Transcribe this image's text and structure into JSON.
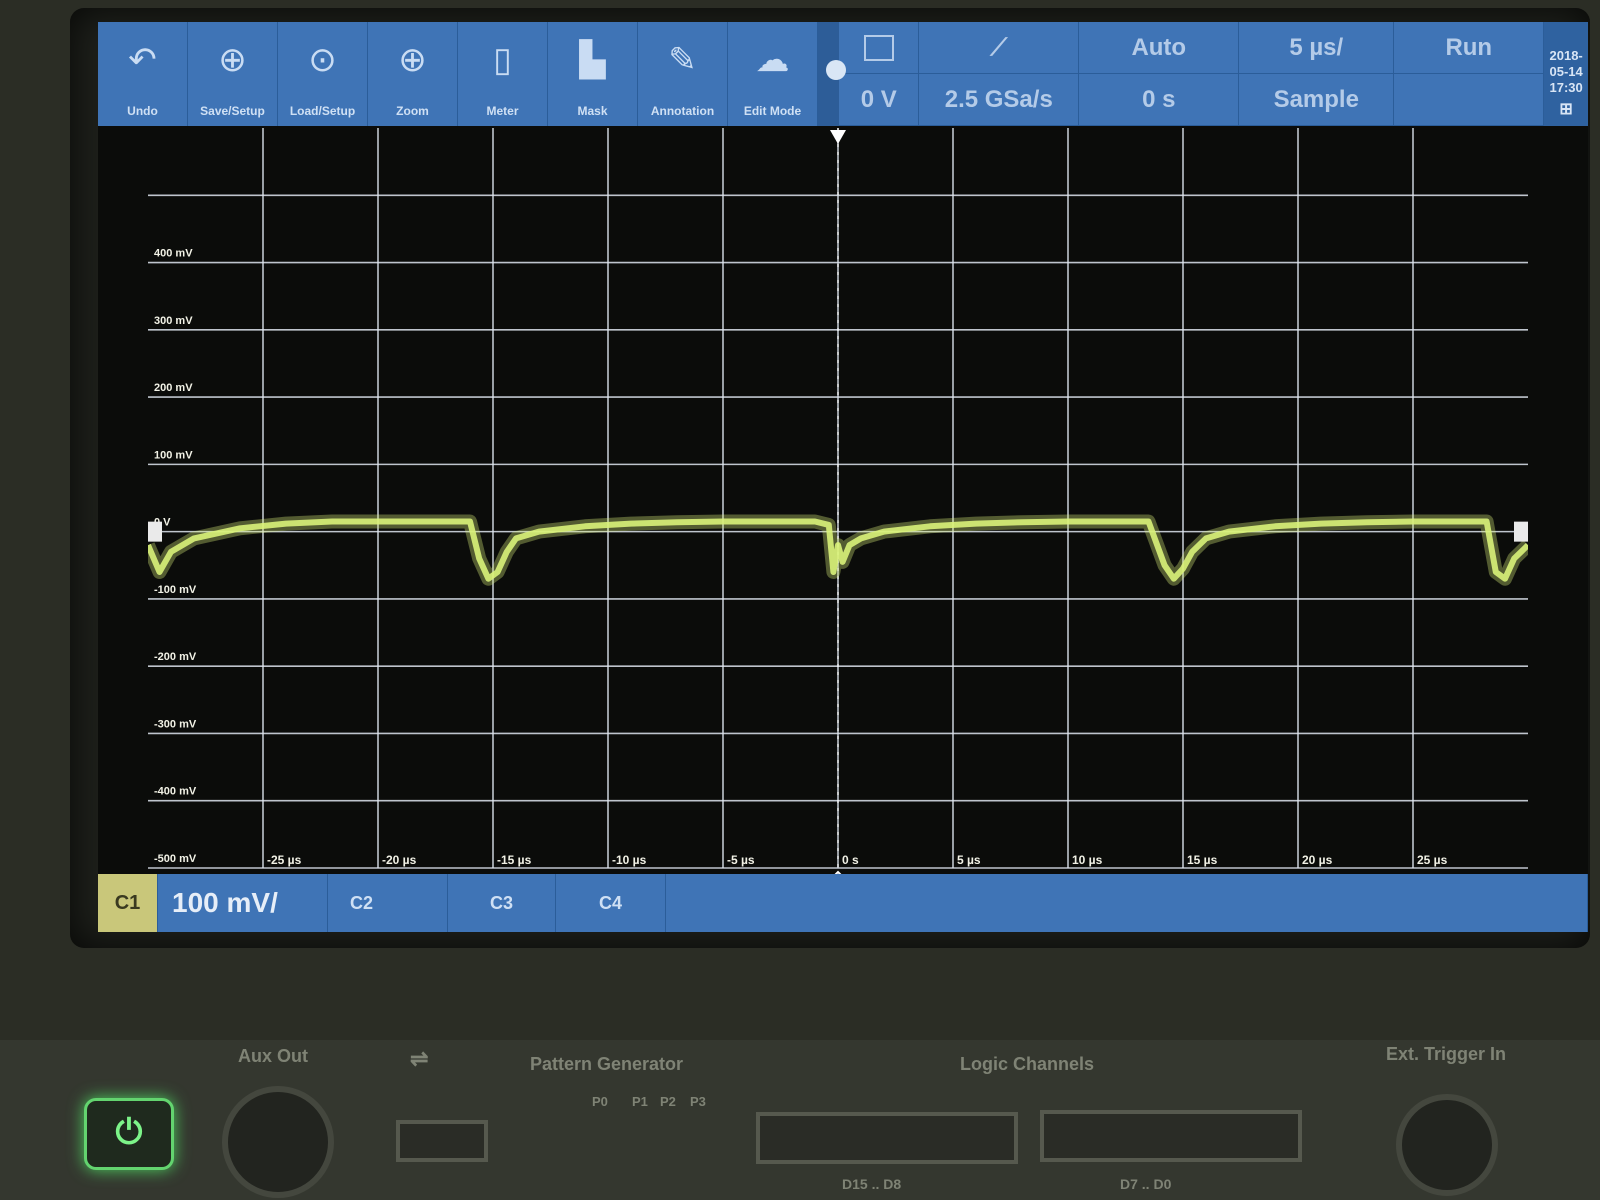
{
  "toolbar": {
    "tools": [
      {
        "label": "Undo",
        "icon": "undo-icon",
        "glyph": "↶"
      },
      {
        "label": "Save/Setup",
        "icon": "save-setup-icon",
        "glyph": "⊕"
      },
      {
        "label": "Load/Setup",
        "icon": "load-setup-icon",
        "glyph": "⊙"
      },
      {
        "label": "Zoom",
        "icon": "zoom-icon",
        "glyph": "⊕"
      },
      {
        "label": "Meter",
        "icon": "meter-icon",
        "glyph": "▯"
      },
      {
        "label": "Mask",
        "icon": "mask-icon",
        "glyph": "▙"
      },
      {
        "label": "Annotation",
        "icon": "annotation-icon",
        "glyph": "✎"
      },
      {
        "label": "Edit Mode",
        "icon": "edit-mode-icon",
        "glyph": "☁"
      }
    ],
    "trigger_type_icon": "trigger-edge-icon",
    "trigger_level": "0 V",
    "trigger_mode": "Auto",
    "sample_rate": "2.5 GSa/s",
    "time_scale": "5 µs/",
    "time_offset": "0 s",
    "run_state": "Run",
    "acquire_mode": "Sample",
    "date": "2018-05-14",
    "time": "17:30"
  },
  "chart_data": {
    "type": "line",
    "title": "",
    "xlabel": "",
    "ylabel": "",
    "x_unit": "µs",
    "y_unit": "mV",
    "xlim": [
      -30,
      30
    ],
    "ylim": [
      -500,
      500
    ],
    "grid": true,
    "x_ticks": [
      -25,
      -20,
      -15,
      -10,
      -5,
      0,
      5,
      10,
      15,
      20,
      25
    ],
    "x_tick_labels": [
      "-25 µs",
      "-20 µs",
      "-15 µs",
      "-10 µs",
      "-5 µs",
      "0 s",
      "5 µs",
      "10 µs",
      "15 µs",
      "20 µs",
      "25 µs"
    ],
    "y_ticks": [
      400,
      300,
      200,
      100,
      0,
      -100,
      -200,
      -300,
      -400,
      -500
    ],
    "y_tick_labels": [
      "400 mV",
      "300 mV",
      "200 mV",
      "100 mV",
      "0 V",
      "-100 mV",
      "-200 mV",
      "-300 mV",
      "-400 mV",
      "-500 mV"
    ],
    "series": [
      {
        "color": "#d9f27a",
        "x": [
          -30,
          -29.5,
          -29,
          -28,
          -26,
          -24,
          -22,
          -20,
          -18,
          -16,
          -15.6,
          -15.2,
          -14.8,
          -14.4,
          -14,
          -13,
          -11,
          -9,
          -7,
          -5,
          -3,
          -1,
          -0.4,
          -0.2,
          0,
          0.2,
          0.5,
          1,
          2,
          4,
          6,
          8,
          10,
          12,
          13.5,
          14.2,
          14.6,
          15,
          15.4,
          16,
          17,
          19,
          21,
          23,
          25,
          27,
          28.2,
          28.6,
          29,
          29.4,
          30
        ],
        "y": [
          -20,
          -60,
          -30,
          -10,
          5,
          12,
          15,
          15,
          15,
          15,
          -40,
          -70,
          -60,
          -30,
          -10,
          0,
          8,
          12,
          14,
          15,
          15,
          15,
          10,
          -60,
          -20,
          -45,
          -20,
          -10,
          0,
          8,
          12,
          14,
          15,
          15,
          15,
          -50,
          -70,
          -55,
          -30,
          -10,
          0,
          8,
          12,
          14,
          15,
          15,
          15,
          -60,
          -70,
          -40,
          -20
        ]
      }
    ]
  },
  "bottom": {
    "ch1_label": "C1",
    "ch1_scale": "100 mV/",
    "ch2_label": "C2",
    "ch3_label": "C3",
    "ch4_label": "C4"
  },
  "panel": {
    "aux_out": "Aux Out",
    "pattern_generator": "Pattern Generator",
    "logic_channels": "Logic Channels",
    "ext_trigger_in": "Ext. Trigger In",
    "pg_pins": [
      "P0",
      "P1",
      "P2",
      "P3"
    ],
    "logic_left": "D15 .. D8",
    "logic_right": "D7 .. D0"
  },
  "colors": {
    "toolbar": "#3f74b6",
    "trace": "#d9f27a",
    "grid": "#dfe6ef",
    "ch1_badge": "#c9c77a"
  }
}
